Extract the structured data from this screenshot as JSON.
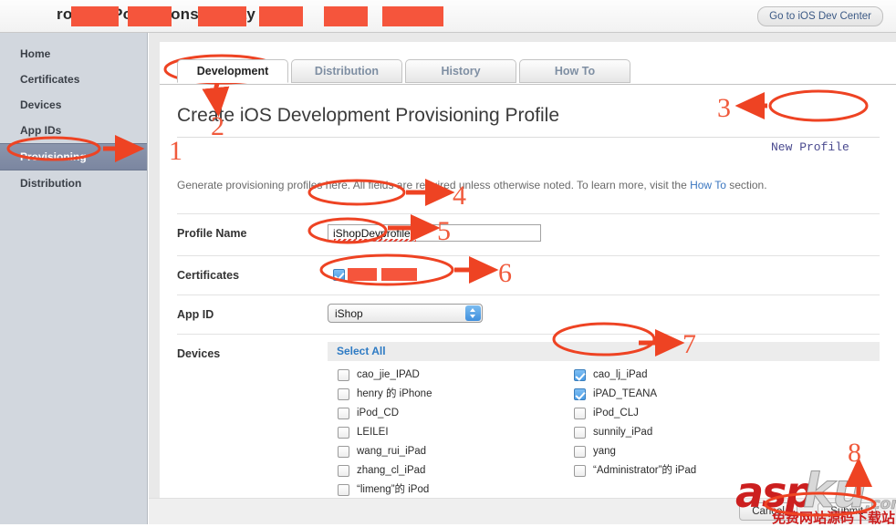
{
  "window": {
    "header_title_visible_fragments": "rovis   a Po   lorv   ons   & te   ay C",
    "dev_center_button": "Go to iOS Dev Center"
  },
  "sidebar": {
    "items": [
      {
        "label": "Home",
        "selected": false
      },
      {
        "label": "Certificates",
        "selected": false
      },
      {
        "label": "Devices",
        "selected": false
      },
      {
        "label": "App IDs",
        "selected": false
      },
      {
        "label": "Provisioning",
        "selected": true
      },
      {
        "label": "Distribution",
        "selected": false
      }
    ]
  },
  "tabs": [
    {
      "label": "Development",
      "active": true
    },
    {
      "label": "Distribution",
      "active": false
    },
    {
      "label": "History",
      "active": false
    },
    {
      "label": "How To",
      "active": false
    }
  ],
  "page": {
    "title": "Create iOS Development Provisioning Profile",
    "new_profile_button": "New Profile",
    "description_before": "Generate provisioning profiles here. All fields are required unless otherwise noted. To learn more, visit the ",
    "description_link": "How To",
    "description_after": " section."
  },
  "form": {
    "profile_name": {
      "label": "Profile Name",
      "value": "iShopDevprofile",
      "placeholder": ""
    },
    "certificates": {
      "label": "Certificates",
      "items": [
        {
          "name_redacted": true,
          "checked": true
        }
      ]
    },
    "app_id": {
      "label": "App ID",
      "value": "iShop",
      "options": [
        "iShop"
      ]
    },
    "devices": {
      "label": "Devices",
      "select_all": "Select All",
      "left_column": [
        {
          "label": "cao_jie_IPAD",
          "checked": false
        },
        {
          "label": "henry 的 iPhone",
          "checked": false
        },
        {
          "label": "iPod_CD",
          "checked": false
        },
        {
          "label": "LEILEI",
          "checked": false
        },
        {
          "label": "wang_rui_iPad",
          "checked": false
        },
        {
          "label": "zhang_cl_iPad",
          "checked": false
        },
        {
          "label": "“limeng”的 iPod",
          "checked": false
        }
      ],
      "right_column": [
        {
          "label": "cao_lj_iPad",
          "checked": true
        },
        {
          "label": "iPAD_TEANA",
          "checked": true
        },
        {
          "label": "iPod_CLJ",
          "checked": false
        },
        {
          "label": "sunnily_iPad",
          "checked": false
        },
        {
          "label": "yang",
          "checked": false
        },
        {
          "label": "“Administrator”的 iPad",
          "checked": false
        }
      ]
    }
  },
  "footer": {
    "cancel_button": "Cancel",
    "submit_button": "Submit"
  },
  "annotations": {
    "markers": [
      "1",
      "2",
      "3",
      "4",
      "5",
      "6",
      "7",
      "8"
    ],
    "color": "#ee4323"
  },
  "watermark": {
    "asp": "asp",
    "ku": "ku",
    "com": ".com",
    "chinese": "免费网站源码下载站"
  }
}
